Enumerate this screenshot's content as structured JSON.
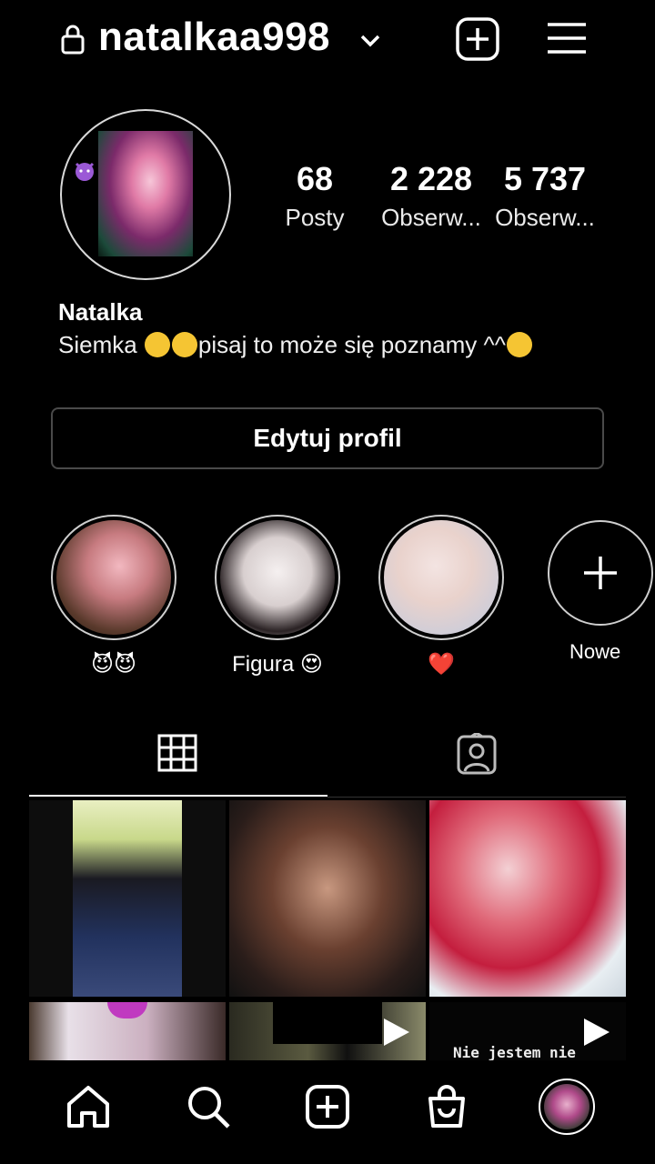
{
  "header": {
    "username": "natalkaa998",
    "icons": [
      "lock-icon",
      "chevron-down-icon",
      "new-post-icon",
      "menu-icon"
    ]
  },
  "profile": {
    "stats": [
      {
        "value": "68",
        "label": "Posty"
      },
      {
        "value": "2 228",
        "label": "Obserw..."
      },
      {
        "value": "5 737",
        "label": "Obserw..."
      }
    ],
    "name": "Natalka",
    "bio_text_1": "Siemka ",
    "bio_text_2": "pisaj to może się poznamy ^^",
    "edit_button": "Edytuj profil"
  },
  "highlights": [
    {
      "label": "😈😈"
    },
    {
      "label": "Figura 😍"
    },
    {
      "label": "❤️"
    },
    {
      "label": "Nowe"
    }
  ],
  "posts": [
    {
      "type": "photo"
    },
    {
      "type": "photo"
    },
    {
      "type": "photo"
    },
    {
      "type": "photo"
    },
    {
      "type": "video"
    },
    {
      "type": "video",
      "caption": "Nie jestem nie"
    }
  ],
  "nav": [
    "home-icon",
    "search-icon",
    "add-icon",
    "shop-icon",
    "profile-avatar"
  ],
  "colors": {
    "background": "#000000",
    "text": "#ffffff",
    "border": "#4a4a4a"
  }
}
